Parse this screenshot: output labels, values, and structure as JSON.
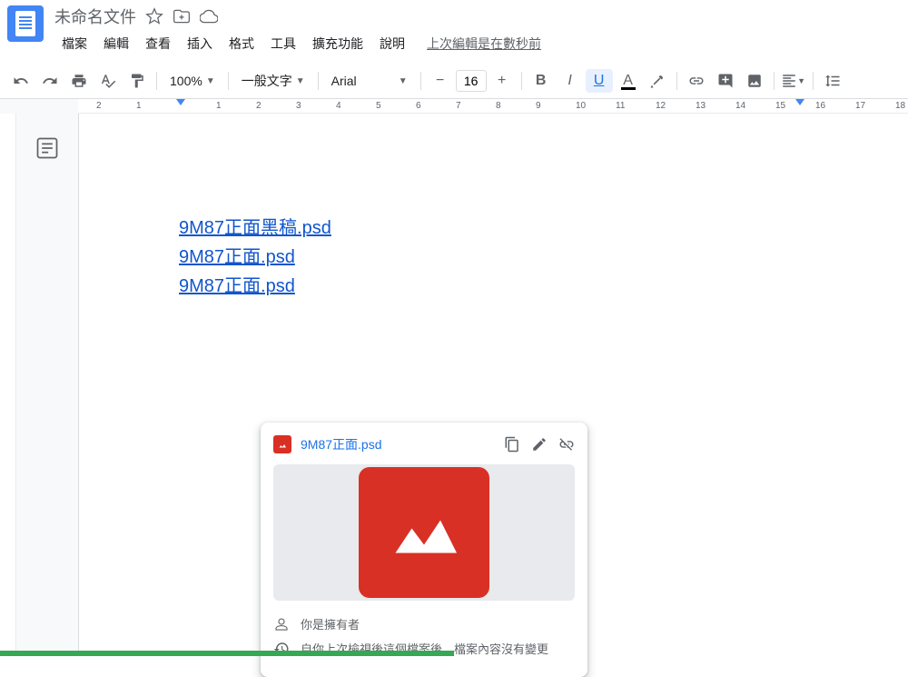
{
  "header": {
    "title": "未命名文件",
    "menus": [
      "檔案",
      "編輯",
      "查看",
      "插入",
      "格式",
      "工具",
      "擴充功能",
      "說明"
    ],
    "edit_status": "上次編輯是在數秒前"
  },
  "toolbar": {
    "zoom": "100%",
    "style": "一般文字",
    "font": "Arial",
    "font_size": "16"
  },
  "ruler_ticks": [
    "2",
    "1",
    "",
    "1",
    "2",
    "3",
    "4",
    "5",
    "6",
    "7",
    "8",
    "9",
    "10",
    "11",
    "12",
    "13",
    "14",
    "15",
    "16",
    "17",
    "18"
  ],
  "content": {
    "links": [
      "9M87正面黑稿.psd",
      "9M87正面.psd",
      "9M87正面.psd"
    ]
  },
  "link_card": {
    "title": "9M87正面.psd",
    "owner_text": "你是擁有者",
    "history_text": "自你上次檢視後這個檔案後，檔案內容沒有變更"
  }
}
